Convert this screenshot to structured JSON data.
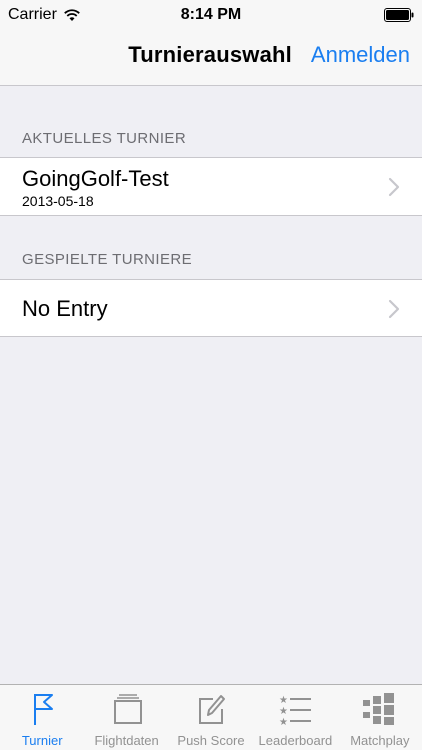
{
  "status_bar": {
    "carrier": "Carrier",
    "time": "8:14 PM",
    "wifi_icon": "wifi-icon",
    "battery_icon": "battery-icon"
  },
  "nav": {
    "title": "Turnierauswahl",
    "action_label": "Anmelden"
  },
  "current_section": {
    "header": "AKTUELLES TURNIER",
    "items": [
      {
        "title": "GoingGolf-Test",
        "subtitle": "2013-05-18"
      }
    ]
  },
  "played_section": {
    "header": "GESPIELTE TURNIERE",
    "items": [
      {
        "title": "No Entry"
      }
    ]
  },
  "tab_bar": {
    "tabs": [
      {
        "label": "Turnier",
        "icon": "flag-icon",
        "active": true
      },
      {
        "label": "Flightdaten",
        "icon": "stack-icon",
        "active": false
      },
      {
        "label": "Push Score",
        "icon": "edit-icon",
        "active": false
      },
      {
        "label": "Leaderboard",
        "icon": "list-stars-icon",
        "active": false
      },
      {
        "label": "Matchplay",
        "icon": "bracket-icon",
        "active": false
      }
    ]
  },
  "colors": {
    "accent": "#1a7ef0",
    "background": "#efeff4",
    "tab_inactive": "#929292"
  }
}
